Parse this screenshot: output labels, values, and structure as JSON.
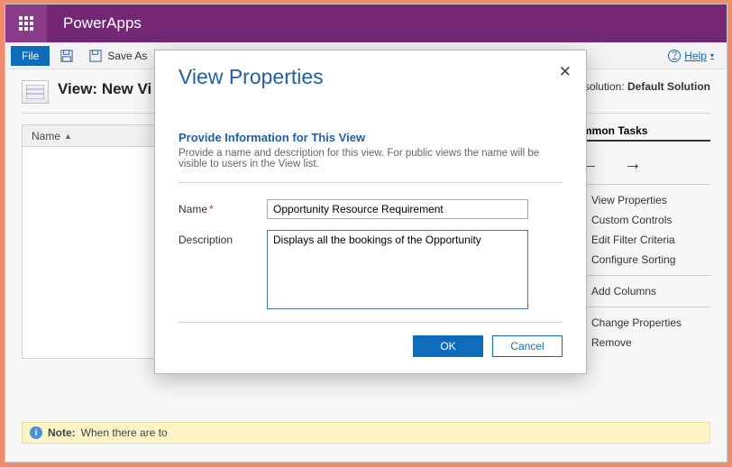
{
  "app": {
    "title": "PowerApps"
  },
  "cmdbar": {
    "file": "File",
    "save_as": "Save As",
    "help": "Help"
  },
  "view_header": {
    "title": "View: New Vi",
    "solution_label": "n solution:",
    "solution_name": "Default Solution"
  },
  "grid": {
    "col_name": "Name"
  },
  "tasks": {
    "title": "Common Tasks",
    "view_props": "View Properties",
    "custom_controls": "Custom Controls",
    "edit_filter": "Edit Filter Criteria",
    "configure_sorting": "Configure Sorting",
    "add_columns": "Add Columns",
    "change_props": "Change Properties",
    "remove": "Remove"
  },
  "note": {
    "label": "Note:",
    "text": "When there are to"
  },
  "modal": {
    "title": "View Properties",
    "section_title": "Provide Information for This View",
    "section_desc": "Provide a name and description for this view. For public views the name will be visible to users in the View list.",
    "name_label": "Name",
    "name_value": "Opportunity Resource Requirement",
    "desc_label": "Description",
    "desc_value": "Displays all the bookings of the Opportunity",
    "ok": "OK",
    "cancel": "Cancel"
  }
}
